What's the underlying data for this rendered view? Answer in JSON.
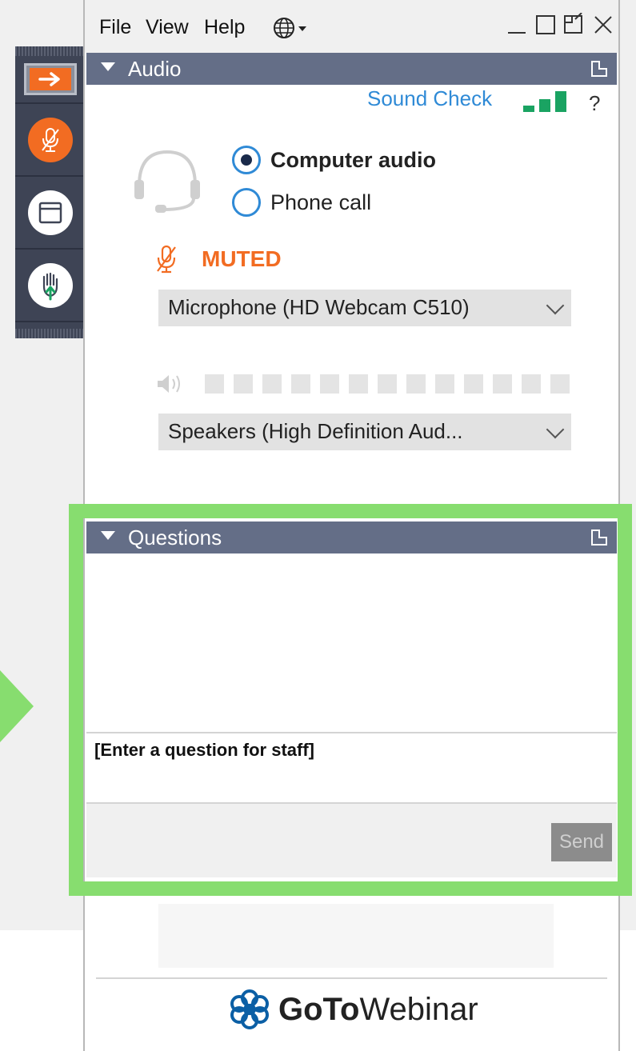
{
  "menubar": {
    "items": [
      "File",
      "View",
      "Help"
    ],
    "language_icon": "globe-icon"
  },
  "audio": {
    "header": "Audio",
    "sound_check": "Sound Check",
    "help": "?",
    "options": [
      "Computer audio",
      "Phone call"
    ],
    "selected_option": "Computer audio",
    "mute_status": "MUTED",
    "microphone": "Microphone (HD Webcam C510)",
    "speakers": "Speakers (High Definition Aud..."
  },
  "questions": {
    "header": "Questions",
    "input_placeholder": "[Enter a question for staff]",
    "send_label": "Send"
  },
  "brand": {
    "logo_bold": "GoTo",
    "logo_regular": "Webinar"
  },
  "colors": {
    "accent_orange": "#f26c22",
    "header_bg": "#646e87",
    "link_blue": "#2f8ad6",
    "highlight_green": "#87dd6f",
    "signal_green": "#1aa362"
  }
}
